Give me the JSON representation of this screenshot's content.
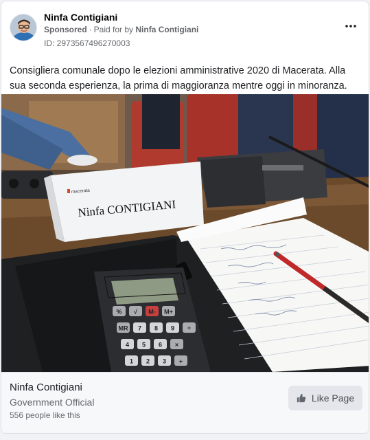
{
  "post": {
    "page_name": "Ninfa Contigiani",
    "sponsored": "Sponsored",
    "paid_for_prefix": "Paid for by",
    "paid_for_by": "Ninfa Contigiani",
    "ad_id": "ID: 2973567496270003",
    "text": "Consigliera comunale dopo le elezioni amministrative 2020 di Macerata. Alla sua seconda esperienza, la prima di maggioranza mentre oggi in minoranza.",
    "more_icon": "more-horizontal-icon"
  },
  "photo": {
    "nameplate_brand": "macerata",
    "nameplate_text": "Ninfa CONTIGIANI",
    "calculator_display": "",
    "keys": [
      "%",
      "√",
      "M-",
      "M+",
      "MR",
      "7",
      "8",
      "9",
      "÷",
      "4",
      "5",
      "6",
      "×",
      "1",
      "2",
      "3",
      "+"
    ]
  },
  "footer": {
    "page_name": "Ninfa Contigiani",
    "category": "Government Official",
    "likes": "556 people like this",
    "like_button_label": "Like Page",
    "like_icon": "thumbs-up-icon"
  },
  "colors": {
    "text_primary": "#1c1e21",
    "text_secondary": "#65676b",
    "button_bg": "#e4e6eb",
    "card_border": "#dddfe2"
  }
}
